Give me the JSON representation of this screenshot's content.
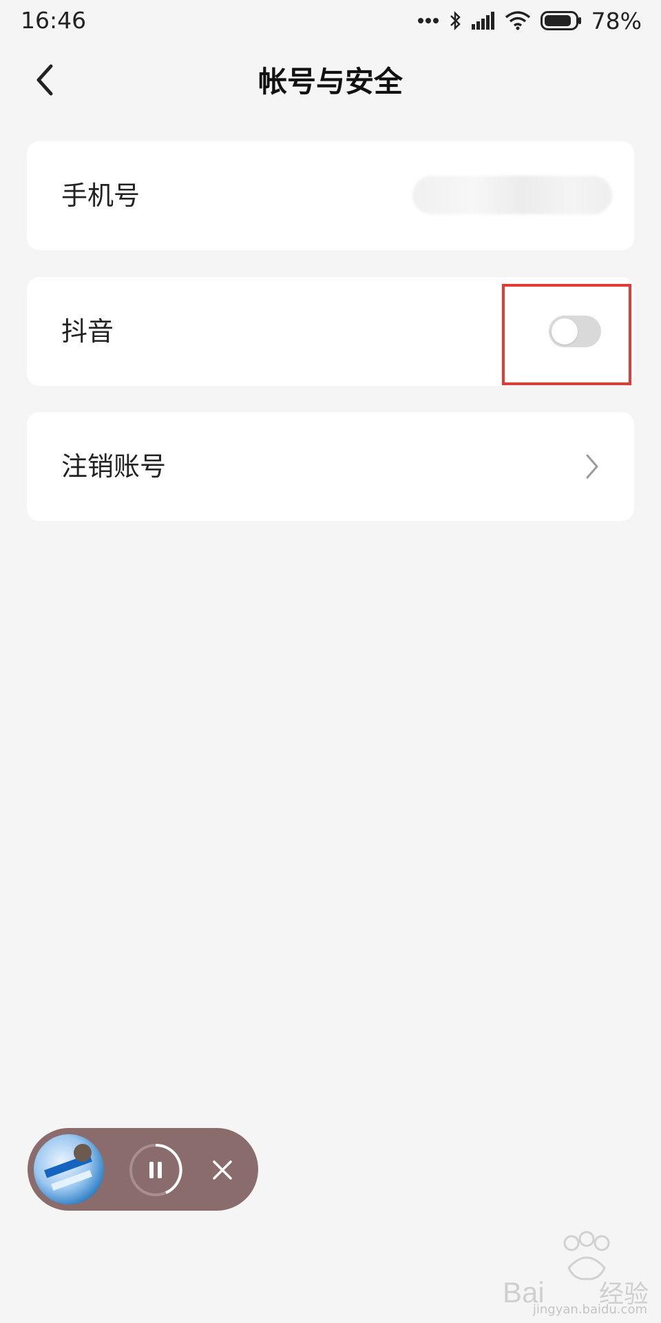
{
  "status_bar": {
    "time": "16:46",
    "battery": "78%",
    "icons": [
      "more-dots-icon",
      "bluetooth-icon",
      "signal-icon",
      "wifi-icon",
      "battery-icon"
    ]
  },
  "header": {
    "title": "帐号与安全",
    "back_icon": "chevron-left-icon"
  },
  "settings": {
    "phone": {
      "label": "手机号",
      "value": ""
    },
    "douyin": {
      "label": "抖音",
      "toggle_on": false
    },
    "cancel_account": {
      "label": "注销账号",
      "icon": "chevron-right-icon"
    }
  },
  "mini_player": {
    "state": "playing",
    "icons": [
      "album-art",
      "pause-icon",
      "close-icon"
    ]
  },
  "watermark": {
    "text": "jingyan.baidu.com",
    "logo": "Bai 经验"
  },
  "colors": {
    "background": "#f5f5f5",
    "card": "#ffffff",
    "highlight": "#e53935",
    "player": "#8a6c6c",
    "toggle_off": "#d9d9d9"
  }
}
